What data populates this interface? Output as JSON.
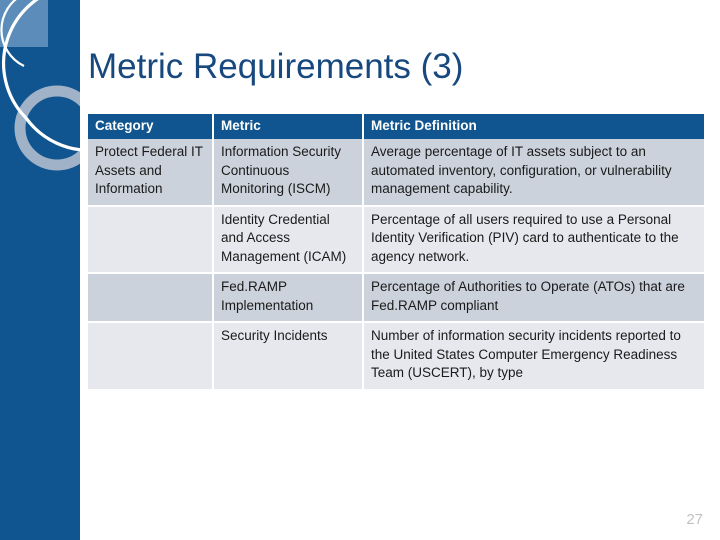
{
  "slide": {
    "title": "Metric Requirements (3)",
    "page_number": "27",
    "accent_color": "#17487e",
    "band_color": "#10558f",
    "header_fill": "#10558f",
    "row_dark": "#ccd2dc",
    "row_light": "#e7e8ee",
    "page_number_color": "#c2c2c2"
  },
  "decoration": {
    "band_fill": "#10558f",
    "square_fill": "#5b8cba",
    "ring_fill": "#9fb2c8",
    "arc_stroke": "#ffffff",
    "name": "circles-decoration"
  },
  "table": {
    "headers": [
      "Category",
      "Metric",
      "Metric Definition"
    ],
    "rows": [
      {
        "category": "Protect Federal IT Assets and Information",
        "metric": "Information Security Continuous Monitoring (ISCM)",
        "definition": "Average percentage of IT assets subject to an automated inventory, configuration, or vulnerability management capability.",
        "band": "dark"
      },
      {
        "category": "",
        "metric": "Identity Credential and Access Management (ICAM)",
        "definition": "Percentage of all users required to use a Personal Identity Verification (PIV) card to authenticate to the agency network.",
        "band": "light"
      },
      {
        "category": "",
        "metric": "Fed.RAMP Implementation",
        "definition": "Percentage of Authorities to Operate (ATOs) that are Fed.RAMP compliant",
        "band": "dark"
      },
      {
        "category": "",
        "metric": "Security Incidents",
        "definition": "Number of information security incidents reported to the United States Computer Emergency Readiness Team (USCERT), by type",
        "band": "light"
      }
    ]
  }
}
